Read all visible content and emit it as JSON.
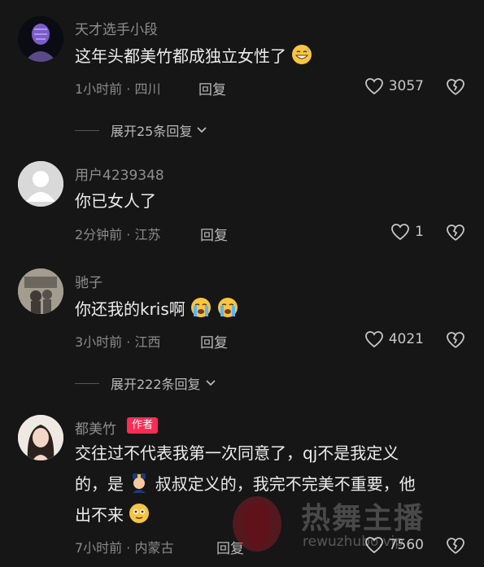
{
  "comments": [
    {
      "username": "天才选手小段",
      "text": "这年头都美竹都成独立女性了",
      "time_location": "1小时前 · 四川",
      "reply_label": "回复",
      "likes": "3057",
      "emoji": "grinning-sweat-emoji"
    },
    {
      "username": "用户4239348",
      "text": "你已女人了",
      "time_location": "2分钟前 · 江苏",
      "reply_label": "回复",
      "likes": "1"
    },
    {
      "username": "驰子",
      "text": "你还我的kris啊",
      "time_location": "3小时前 · 江西",
      "reply_label": "回复",
      "likes": "4021",
      "emoji": "loudly-crying-emoji"
    },
    {
      "username": "都美竹",
      "author_badge": "作者",
      "text_line1": "交往过不代表我第一次同意了，qj不是我定义",
      "text_line2_a": "的，是",
      "text_line2_b": "叔叔定义的，我完不完美不重要，他",
      "text_line3": "出不来",
      "time_location": "7小时前 · 内蒙古",
      "reply_label": "回复",
      "likes": "7560",
      "emoji_police": "police-officer-emoji",
      "emoji_end": "flushed-smile-emoji"
    }
  ],
  "expand_1": "展开25条回复",
  "expand_2": "展开222条回复",
  "watermark": {
    "text": "热舞主播",
    "url": "rewuzhubo.vip"
  },
  "colors": {
    "background": "#161616",
    "badge": "#fe2c55"
  }
}
